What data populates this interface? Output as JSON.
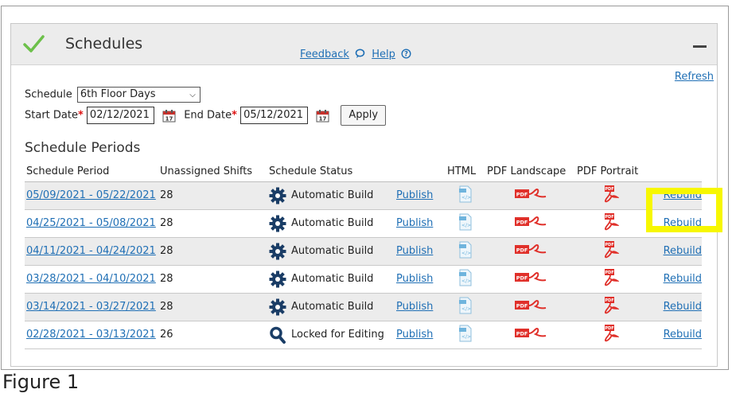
{
  "panel": {
    "title": "Schedules",
    "feedback_label": "Feedback",
    "help_label": "Help",
    "refresh_label": "Refresh"
  },
  "form": {
    "schedule_label": "Schedule",
    "schedule_value": "6th Floor Days",
    "start_label": "Start Date",
    "start_value": "02/12/2021",
    "end_label": "End Date",
    "end_value": "05/12/2021",
    "required_mark": "*",
    "apply_label": "Apply"
  },
  "section": {
    "title": "Schedule Periods"
  },
  "table": {
    "headers": [
      "Schedule Period",
      "Unassigned Shifts",
      "Schedule Status",
      "",
      "HTML",
      "PDF Landscape",
      "PDF Portrait",
      ""
    ],
    "rows": [
      {
        "period": "05/09/2021 - 05/22/2021",
        "shifts": "28",
        "status": "Automatic Build",
        "status_icon": "gear-icon",
        "publish": "Publish",
        "rebuild": "Rebuild"
      },
      {
        "period": "04/25/2021 - 05/08/2021",
        "shifts": "28",
        "status": "Automatic Build",
        "status_icon": "gear-icon",
        "publish": "Publish",
        "rebuild": "Rebuild"
      },
      {
        "period": "04/11/2021 - 04/24/2021",
        "shifts": "28",
        "status": "Automatic Build",
        "status_icon": "gear-icon",
        "publish": "Publish",
        "rebuild": "Rebuild"
      },
      {
        "period": "03/28/2021 - 04/10/2021",
        "shifts": "28",
        "status": "Automatic Build",
        "status_icon": "gear-icon",
        "publish": "Publish",
        "rebuild": "Rebuild"
      },
      {
        "period": "03/14/2021 - 03/27/2021",
        "shifts": "28",
        "status": "Automatic Build",
        "status_icon": "gear-icon",
        "publish": "Publish",
        "rebuild": "Rebuild"
      },
      {
        "period": "02/28/2021 - 03/13/2021",
        "shifts": "26",
        "status": "Locked for Editing",
        "status_icon": "magnifier-icon",
        "publish": "Publish",
        "rebuild": "Rebuild"
      }
    ]
  },
  "icons": {
    "html": "html-file-icon",
    "pdf_landscape": "pdf-landscape-icon",
    "pdf_portrait": "pdf-portrait-icon",
    "calendar": "calendar-icon",
    "check": "check-icon"
  },
  "colors": {
    "link": "#1f6fb5",
    "check": "#6cc04a",
    "highlight": "#f7f700",
    "pdf": "#e0302a",
    "status_icon": "#1a3d66"
  },
  "caption": "Figure 1"
}
